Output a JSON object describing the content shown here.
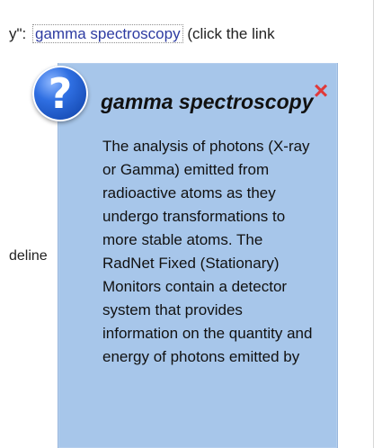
{
  "background": {
    "top_prefix": "y\":",
    "link_text": "gamma spectroscopy",
    "top_suffix": " (click the link",
    "side_text": "deline"
  },
  "popup": {
    "title": "gamma spectroscopy",
    "body": "The analysis of photons (X-ray or Gamma) emitted from radioactive atoms as they undergo transformations to more stable atoms. The RadNet Fixed (Stationary) Monitors contain a detector system that provides information on the quantity and energy of photons emitted by",
    "close_glyph": "×",
    "help_glyph": "?"
  },
  "colors": {
    "popup_background": "#a7c6ea",
    "link": "#2e3ca2",
    "close": "#e03a3a",
    "help_icon": "#2f6fe2"
  },
  "icons": {
    "help": "help-icon",
    "close": "close-icon"
  }
}
